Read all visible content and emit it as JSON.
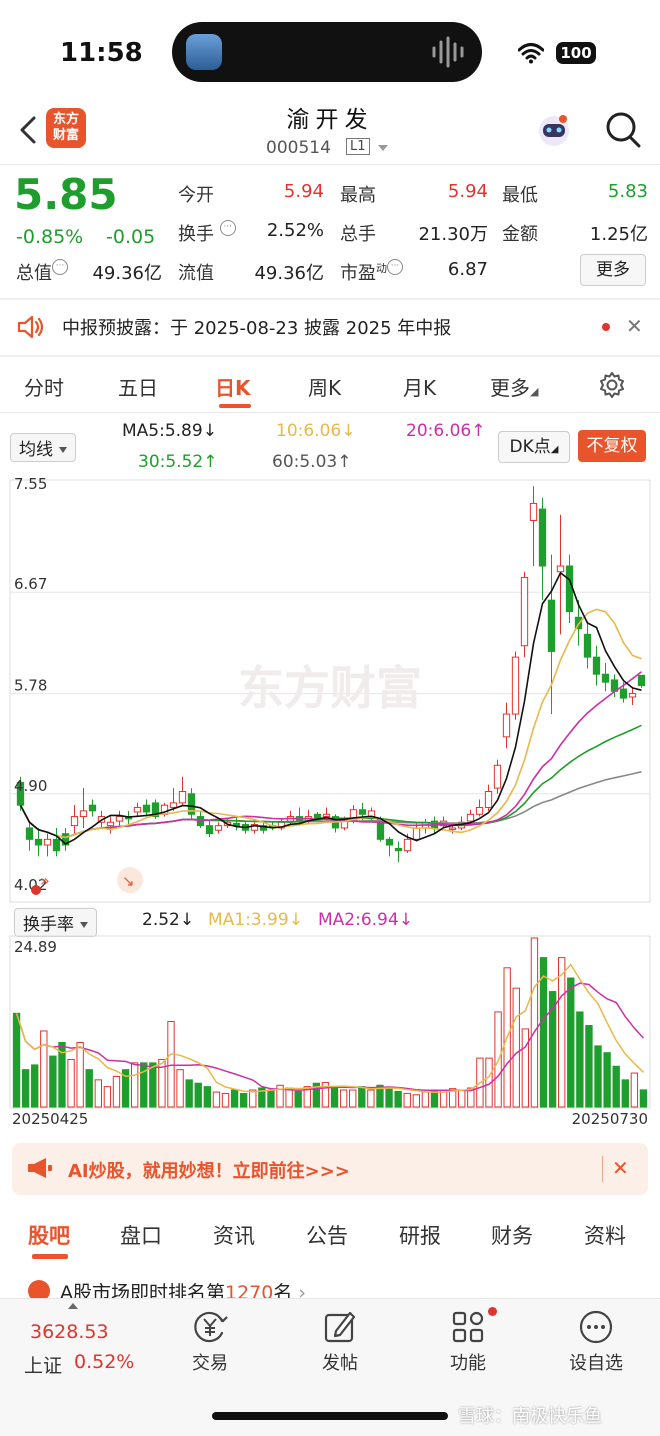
{
  "status_bar": {
    "time": "11:58",
    "battery": "100"
  },
  "header": {
    "logo_text_1": "东方",
    "logo_text_2": "财富",
    "stock_name": "渝开发",
    "stock_code": "000514",
    "level": "L1"
  },
  "quote": {
    "price": "5.85",
    "change_pct": "-0.85%",
    "change_abs": "-0.05",
    "open_label": "今开",
    "open": "5.94",
    "high_label": "最高",
    "high": "5.94",
    "low_label": "最低",
    "low": "5.83",
    "turnover_label": "换手",
    "turnover": "2.52%",
    "volume_label": "总手",
    "volume": "21.30万",
    "amount_label": "金额",
    "amount": "1.25亿",
    "total_mv_label": "总值",
    "total_mv": "49.36亿",
    "float_mv_label": "流值",
    "float_mv": "49.36亿",
    "pe_label": "市盈",
    "pe_sup": "动",
    "pe": "6.87",
    "more_label": "更多"
  },
  "notice": {
    "text": "中报预披露：于 2025-08-23 披露 2025 年中报",
    "close": "✕"
  },
  "period_tabs": [
    "分时",
    "五日",
    "日K",
    "周K",
    "月K",
    "更多"
  ],
  "period_active": "日K",
  "ma": {
    "selector": "均线",
    "ma5": "MA5:5.89",
    "ma5_arrow": "↓",
    "ma10": "10:6.06",
    "ma10_arrow": "↓",
    "ma20": "20:6.06",
    "ma20_arrow": "↑",
    "ma30": "30:5.52",
    "ma30_arrow": "↑",
    "ma60": "60:5.03",
    "ma60_arrow": "↑",
    "dk_label": "DK点",
    "fuquan_label": "不复权",
    "colors": {
      "ma5": "#111111",
      "ma10": "#e8b84a",
      "ma20": "#cc2fa8",
      "ma30": "#1e9e2c",
      "ma60": "#888888"
    }
  },
  "chart_data": [
    {
      "type": "candlestick",
      "title": "",
      "y_ticks": [
        "7.55",
        "6.67",
        "5.78",
        "4.90",
        "4.02"
      ],
      "ylim": [
        4.02,
        7.55
      ],
      "watermark": "东方财富",
      "candles": [
        [
          5.0,
          4.8,
          5.05,
          4.75
        ],
        [
          4.6,
          4.5,
          4.65,
          4.4
        ],
        [
          4.5,
          4.45,
          4.6,
          4.35
        ],
        [
          4.45,
          4.5,
          4.55,
          4.35
        ],
        [
          4.5,
          4.4,
          4.6,
          4.35
        ],
        [
          4.55,
          4.45,
          4.6,
          4.4
        ],
        [
          4.62,
          4.7,
          4.8,
          4.55
        ],
        [
          4.7,
          4.75,
          4.95,
          4.6
        ],
        [
          4.8,
          4.75,
          4.85,
          4.7
        ],
        [
          4.65,
          4.7,
          4.75,
          4.6
        ],
        [
          4.62,
          4.65,
          4.7,
          4.55
        ],
        [
          4.66,
          4.7,
          4.75,
          4.6
        ],
        [
          4.7,
          4.68,
          4.75,
          4.62
        ],
        [
          4.74,
          4.78,
          4.82,
          4.7
        ],
        [
          4.8,
          4.74,
          4.85,
          4.7
        ],
        [
          4.82,
          4.7,
          4.85,
          4.68
        ],
        [
          4.72,
          4.8,
          4.82,
          4.7
        ],
        [
          4.78,
          4.82,
          4.95,
          4.75
        ],
        [
          4.82,
          4.92,
          5.05,
          4.8
        ],
        [
          4.9,
          4.72,
          4.95,
          4.68
        ],
        [
          4.7,
          4.62,
          4.75,
          4.6
        ],
        [
          4.62,
          4.55,
          4.66,
          4.52
        ],
        [
          4.58,
          4.62,
          4.65,
          4.55
        ],
        [
          4.62,
          4.65,
          4.68,
          4.6
        ],
        [
          4.64,
          4.62,
          4.7,
          4.58
        ],
        [
          4.63,
          4.58,
          4.66,
          4.55
        ],
        [
          4.58,
          4.63,
          4.65,
          4.55
        ],
        [
          4.62,
          4.58,
          4.65,
          4.55
        ],
        [
          4.62,
          4.6,
          4.66,
          4.58
        ],
        [
          4.6,
          4.65,
          4.68,
          4.58
        ],
        [
          4.66,
          4.7,
          4.75,
          4.62
        ],
        [
          4.7,
          4.66,
          4.78,
          4.62
        ],
        [
          4.66,
          4.7,
          4.76,
          4.63
        ],
        [
          4.72,
          4.68,
          4.74,
          4.65
        ],
        [
          4.7,
          4.72,
          4.78,
          4.66
        ],
        [
          4.7,
          4.6,
          4.72,
          4.56
        ],
        [
          4.6,
          4.68,
          4.7,
          4.58
        ],
        [
          4.66,
          4.76,
          4.8,
          4.64
        ],
        [
          4.76,
          4.72,
          4.82,
          4.66
        ],
        [
          4.7,
          4.75,
          4.78,
          4.65
        ],
        [
          4.68,
          4.5,
          4.7,
          4.48
        ],
        [
          4.5,
          4.45,
          4.52,
          4.35
        ],
        [
          4.42,
          4.4,
          4.48,
          4.3
        ],
        [
          4.4,
          4.5,
          4.55,
          4.38
        ],
        [
          4.5,
          4.6,
          4.65,
          4.48
        ],
        [
          4.6,
          4.65,
          4.68,
          4.55
        ],
        [
          4.66,
          4.6,
          4.7,
          4.55
        ],
        [
          4.62,
          4.66,
          4.7,
          4.6
        ],
        [
          4.6,
          4.6,
          4.64,
          4.55
        ],
        [
          4.6,
          4.65,
          4.7,
          4.58
        ],
        [
          4.66,
          4.72,
          4.76,
          4.62
        ],
        [
          4.72,
          4.78,
          4.85,
          4.7
        ],
        [
          4.78,
          4.92,
          4.98,
          4.75
        ],
        [
          4.95,
          5.15,
          5.2,
          4.9
        ],
        [
          5.4,
          5.6,
          5.7,
          5.3
        ],
        [
          5.6,
          6.1,
          6.15,
          5.55
        ],
        [
          6.2,
          6.8,
          6.85,
          6.1
        ],
        [
          7.3,
          7.45,
          7.6,
          6.9
        ],
        [
          7.4,
          6.9,
          7.5,
          6.6
        ],
        [
          6.6,
          6.15,
          7.0,
          5.6
        ],
        [
          6.85,
          6.9,
          7.35,
          6.3
        ],
        [
          6.9,
          6.5,
          7.0,
          6.4
        ],
        [
          6.45,
          6.35,
          6.6,
          6.2
        ],
        [
          6.3,
          6.1,
          6.4,
          6.0
        ],
        [
          6.1,
          5.95,
          6.2,
          5.85
        ],
        [
          5.95,
          5.88,
          6.05,
          5.8
        ],
        [
          5.9,
          5.8,
          5.95,
          5.75
        ],
        [
          5.82,
          5.74,
          5.88,
          5.7
        ],
        [
          5.75,
          5.78,
          5.84,
          5.68
        ],
        [
          5.94,
          5.85,
          5.94,
          5.83
        ]
      ]
    },
    {
      "type": "bar",
      "title": "",
      "indicator_selector": "换手率",
      "value_label": "2.52",
      "value_arrow": "↓",
      "ma1": "MA1:3.99",
      "ma1_arrow": "↓",
      "ma2": "MA2:6.94",
      "ma2_arrow": "↓",
      "ymax_label": "24.89",
      "ylim": [
        0,
        24.89
      ],
      "x_start": "20250425",
      "x_end": "20250730",
      "values": [
        13.8,
        5.5,
        6.2,
        11.2,
        7.5,
        9.5,
        7.0,
        9.5,
        5.5,
        4.0,
        3.0,
        4.5,
        5.5,
        6.5,
        6.5,
        6.5,
        7.0,
        12.6,
        5.5,
        4.0,
        3.5,
        3.0,
        2.2,
        2.0,
        2.5,
        2.0,
        2.5,
        2.8,
        2.5,
        3.2,
        2.8,
        2.3,
        3.0,
        3.5,
        3.6,
        2.8,
        2.5,
        2.5,
        3.0,
        2.5,
        3.2,
        2.8,
        2.3,
        2.0,
        1.8,
        2.2,
        2.5,
        2.5,
        2.7,
        2.5,
        2.8,
        7.2,
        7.2,
        14.0,
        20.5,
        17.5,
        11.5,
        24.89,
        22.0,
        17.0,
        22.0,
        19.0,
        14.0,
        12.0,
        9.0,
        8.0,
        6.0,
        4.0,
        5.0,
        2.52
      ]
    }
  ],
  "ai_banner": {
    "text": "AI炒股，就用妙想！立即前往>>>",
    "close": "✕"
  },
  "bottom_tabs": [
    "股吧",
    "盘口",
    "资讯",
    "公告",
    "研报",
    "财务",
    "资料"
  ],
  "bottom_tab_active": "股吧",
  "ranking": {
    "prefix": "A股市场即时排名第",
    "rank": "1270",
    "suffix": "名"
  },
  "bottom_nav": {
    "index_value": "3628.53",
    "index_name": "上证",
    "index_pct": "0.52%",
    "items": [
      "交易",
      "发帖",
      "功能",
      "设自选"
    ]
  },
  "watermark": "雪球：南极快乐鱼"
}
